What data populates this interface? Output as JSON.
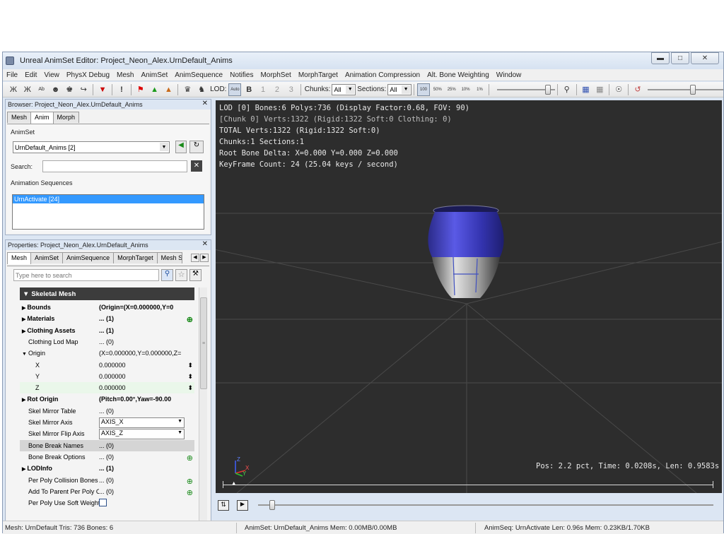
{
  "window": {
    "title": "Unreal AnimSet Editor: Project_Neon_Alex.UrnDefault_Anims"
  },
  "menu": [
    "File",
    "Edit",
    "View",
    "PhysX Debug",
    "Mesh",
    "AnimSet",
    "AnimSequence",
    "Notifies",
    "MorphSet",
    "MorphTarget",
    "Animation Compression",
    "Alt. Bone Weighting",
    "Window"
  ],
  "toolbar": {
    "lod_label": "LOD:",
    "lod_buttons": [
      "Auto",
      "B",
      "1",
      "2",
      "3"
    ],
    "chunks_label": "Chunks:",
    "chunks_value": "All",
    "sections_label": "Sections:",
    "sections_value": "All",
    "speed_buttons": [
      "100",
      "50%",
      "25%",
      "10%",
      "1%"
    ]
  },
  "browser": {
    "title": "Browser: Project_Neon_Alex.UrnDefault_Anims",
    "tabs": [
      "Mesh",
      "Anim",
      "Morph"
    ],
    "animset_label": "AnimSet",
    "animset_value": "UrnDefault_Anims [2]",
    "search_label": "Search:",
    "sequences_label": "Animation Sequences",
    "sequences": [
      "UrnActivate [24]"
    ]
  },
  "properties": {
    "title": "Properties: Project_Neon_Alex.UrnDefault_Anims",
    "tabs": [
      "Mesh",
      "AnimSet",
      "AnimSequence",
      "MorphTarget",
      "Mesh Sir"
    ],
    "search_placeholder": "Type here to search",
    "category": "Skeletal Mesh",
    "rows": [
      {
        "key": "Bounds",
        "value": "(Origin=(X=0.000000,Y=0",
        "expand": "right",
        "bold": true
      },
      {
        "key": "Materials",
        "value": "... (1)",
        "expand": "right",
        "bold": true
      },
      {
        "key": "Clothing Assets",
        "value": "... (1)",
        "expand": "right",
        "bold": true
      },
      {
        "key": "Clothing Lod Map",
        "value": "... (0)",
        "expand": "",
        "bold": false
      },
      {
        "key": "Origin",
        "value": "(X=0.000000,Y=0.000000,Z=",
        "expand": "down",
        "bold": false
      },
      {
        "key": "X",
        "value": "0.000000",
        "expand": "",
        "bold": false,
        "indent": true
      },
      {
        "key": "Y",
        "value": "0.000000",
        "expand": "",
        "bold": false,
        "indent": true
      },
      {
        "key": "Z",
        "value": "0.000000",
        "expand": "",
        "bold": false,
        "indent": true
      },
      {
        "key": "Rot Origin",
        "value": "(Pitch=0.00°,Yaw=-90.00",
        "expand": "right",
        "bold": true
      },
      {
        "key": "Skel Mirror Table",
        "value": "... (0)",
        "expand": "",
        "bold": false
      },
      {
        "key": "Skel Mirror Axis",
        "value": "AXIS_X",
        "expand": "",
        "bold": false,
        "combo": true
      },
      {
        "key": "Skel Mirror Flip Axis",
        "value": "AXIS_Z",
        "expand": "",
        "bold": false,
        "combo": true
      },
      {
        "key": "Bone Break Names",
        "value": "... (0)",
        "expand": "",
        "bold": false
      },
      {
        "key": "Bone Break Options",
        "value": "... (0)",
        "expand": "",
        "bold": false
      },
      {
        "key": "LODInfo",
        "value": "... (1)",
        "expand": "right",
        "bold": true
      },
      {
        "key": "Per Poly Collision Bones",
        "value": "... (0)",
        "expand": "",
        "bold": false
      },
      {
        "key": "Add To Parent Per Poly Co",
        "value": "... (0)",
        "expand": "",
        "bold": false
      },
      {
        "key": "Per Poly Use Soft Weightin",
        "value": "",
        "expand": "",
        "bold": false,
        "checkbox": true
      }
    ]
  },
  "viewport": {
    "lines": [
      "LOD [0] Bones:6 Polys:736 (Display Factor:0.68, FOV: 90)",
      " [Chunk 0] Verts:1322 (Rigid:1322 Soft:0 Clothing: 0)",
      "TOTAL Verts:1322 (Rigid:1322 Soft:0)",
      "Chunks:1 Sections:1",
      "Root Bone Delta: X=0.000 Y=0.000 Z=0.000",
      "KeyFrame Count: 24 (25.04 keys / second)"
    ],
    "playback_info": "Pos: 2.2 pct, Time: 0.0208s, Len: 0.9583s",
    "axis_labels": [
      "Z",
      "X",
      "Y"
    ]
  },
  "playback": {
    "position_fraction": 0.022
  },
  "status": {
    "mesh": "Mesh: UrnDefault  Tris: 736  Bones: 6",
    "animset": "AnimSet: UrnDefault_Anims  Mem: 0.00MB/0.00MB",
    "animseq": "AnimSeq: UrnActivate  Len: 0.96s  Mem: 0.23KB/1.70KB"
  },
  "colors": {
    "urn_blue": "#3c3cc8",
    "viewport_bg": "#2d2d2d",
    "selection": "#3399ff"
  }
}
